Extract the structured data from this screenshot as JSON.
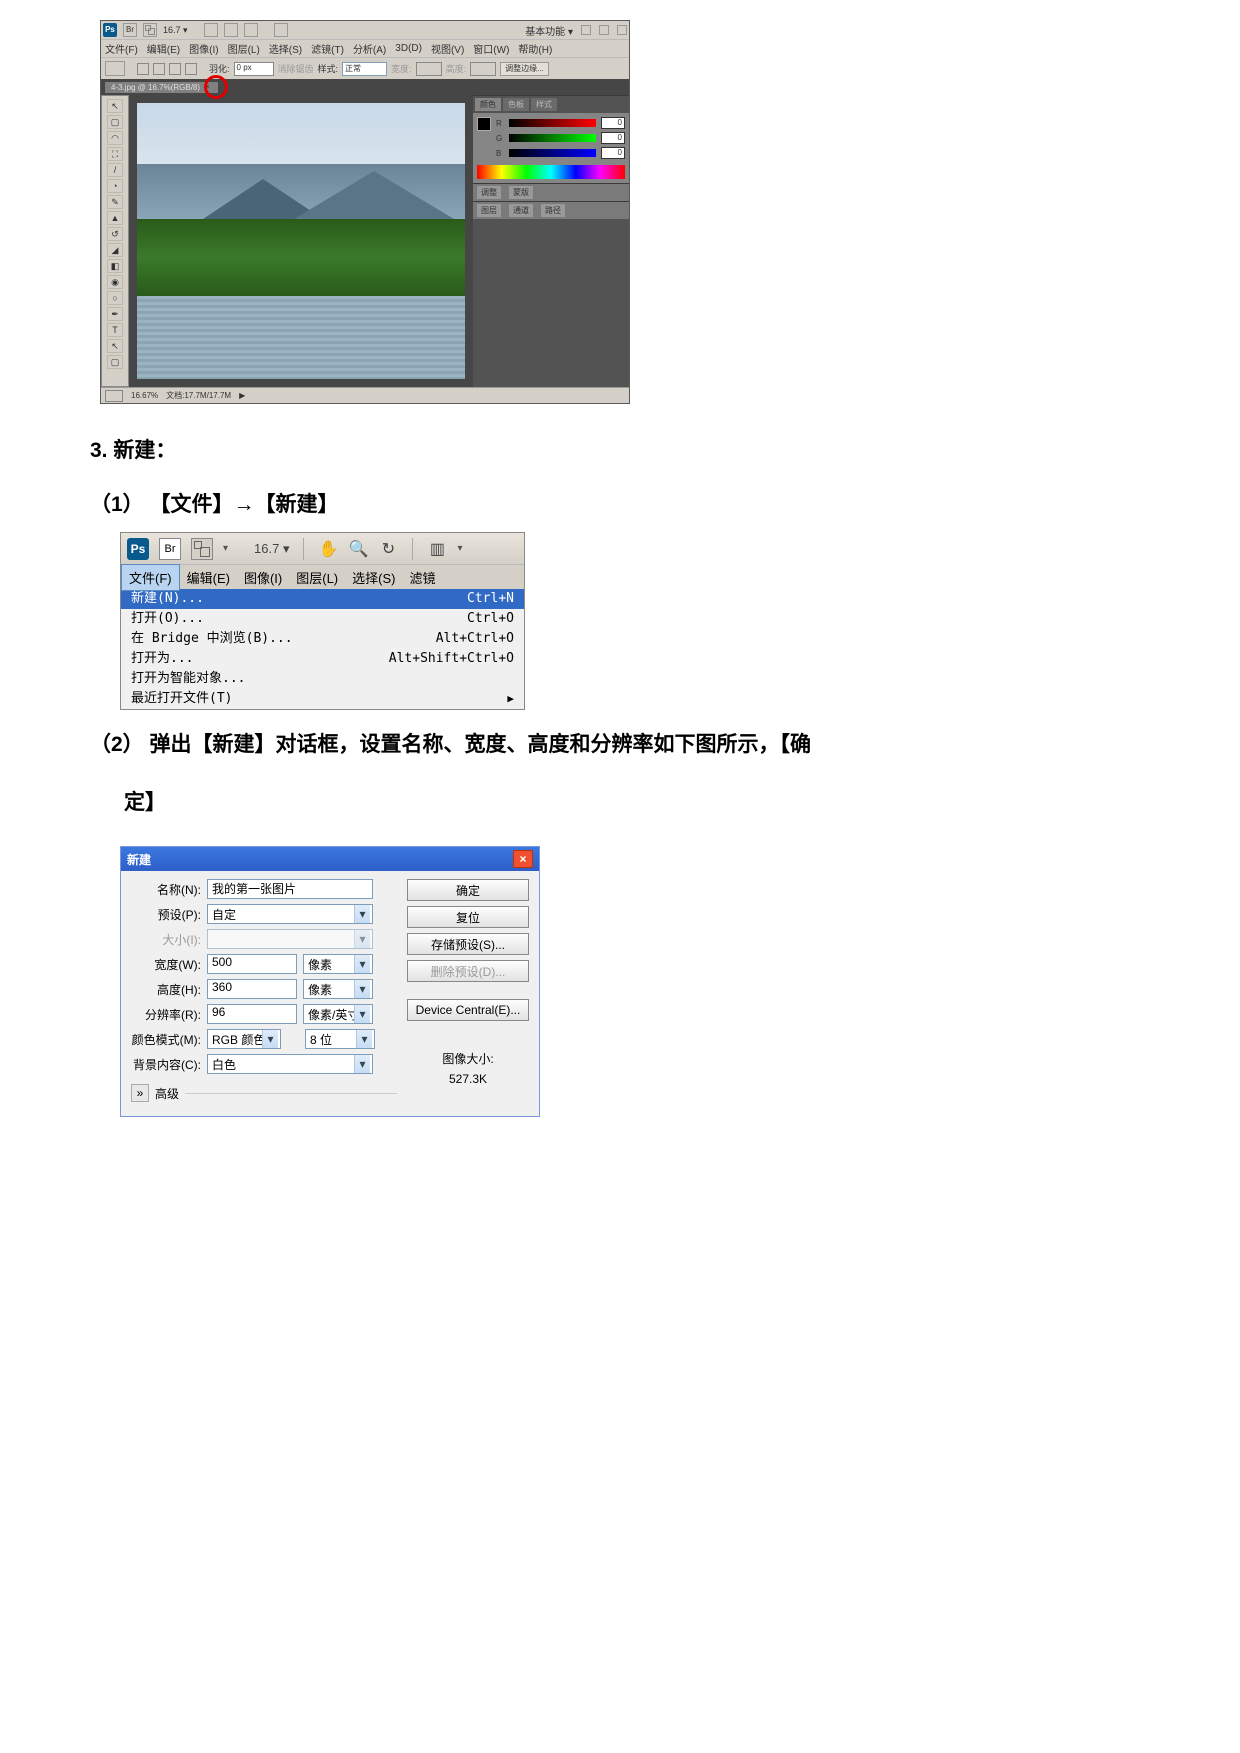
{
  "shot1": {
    "br_label": "Br",
    "zoom_label": "16.7 ▾",
    "basic_label": "基本功能 ▾",
    "menubar": {
      "file": "文件(F)",
      "edit": "编辑(E)",
      "image": "图像(I)",
      "layer": "图层(L)",
      "select": "选择(S)",
      "filter": "滤镜(T)",
      "analysis": "分析(A)",
      "_3d": "3D(D)",
      "view": "视图(V)",
      "window": "窗口(W)",
      "help": "帮助(H)"
    },
    "options": {
      "feather_label": "羽化:",
      "feather_value": "0 px",
      "antialias": "消除锯齿",
      "style_label": "样式:",
      "style_value": "正常",
      "width_label": "宽度:",
      "height_label": "高度:",
      "refine_label": "调整边缘..."
    },
    "tab_title": "4-3.jpg @ 16.7%(RGB/8)",
    "status_zoom": "16.67%",
    "status_doc": "文档:17.7M/17.7M",
    "panels": {
      "color_tab": "颜色",
      "swatch_tab": "色板",
      "style_tab": "样式",
      "r": "R",
      "g": "G",
      "b": "B",
      "val": "0",
      "adj_tab": "调整",
      "mask_tab": "蒙版",
      "layer_tab": "图层",
      "channel_tab": "通道",
      "path_tab": "路径"
    }
  },
  "text": {
    "h3": "3. 新建：",
    "step1": "（1） 【文件】→【新建】",
    "step2": "（2） 弹出【新建】对话框，设置名称、宽度、高度和分辨率如下图所示，【确",
    "step2b": "定】"
  },
  "shot2": {
    "br_label": "Br",
    "zoom_label": "16.7 ▾",
    "menubar": {
      "file": "文件(F)",
      "edit": "编辑(E)",
      "image": "图像(I)",
      "layer": "图层(L)",
      "select": "选择(S)",
      "filter": "滤镜"
    },
    "items": {
      "new_l": "新建(N)...",
      "new_r": "Ctrl+N",
      "open_l": "打开(O)...",
      "open_r": "Ctrl+O",
      "bridge_l": "在 Bridge 中浏览(B)...",
      "bridge_r": "Alt+Ctrl+O",
      "openas_l": "打开为...",
      "openas_r": "Alt+Shift+Ctrl+O",
      "smart_l": "打开为智能对象...",
      "recent_l": "最近打开文件(T)"
    }
  },
  "shot3": {
    "title": "新建",
    "labels": {
      "name": "名称(N):",
      "preset": "预设(P):",
      "size": "大小(I):",
      "width": "宽度(W):",
      "height": "高度(H):",
      "res": "分辨率(R):",
      "mode": "颜色模式(M):",
      "bg": "背景内容(C):",
      "adv": "高级"
    },
    "values": {
      "name": "我的第一张图片",
      "preset": "自定",
      "width": "500",
      "width_u": "像素",
      "height": "360",
      "height_u": "像素",
      "res": "96",
      "res_u": "像素/英寸",
      "mode": "RGB 颜色",
      "bits": "8 位",
      "bg": "白色"
    },
    "buttons": {
      "ok": "确定",
      "reset": "复位",
      "save_preset": "存储预设(S)...",
      "del_preset": "删除预设(D)...",
      "device": "Device Central(E)..."
    },
    "size_label": "图像大小:",
    "size_value": "527.3K"
  }
}
